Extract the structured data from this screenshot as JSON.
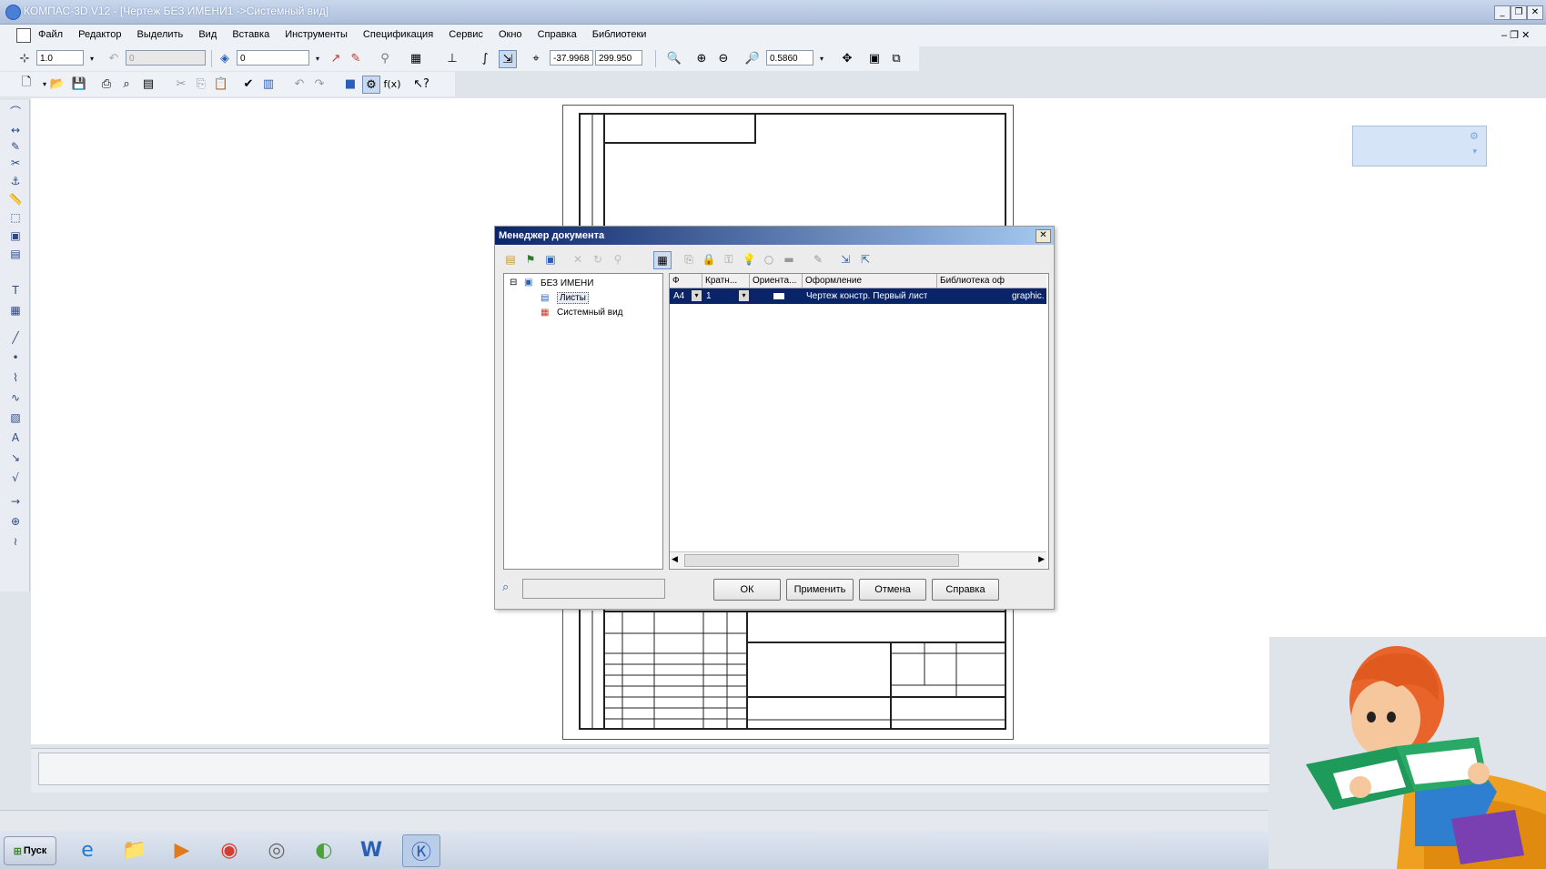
{
  "window": {
    "title": "КОМПАС-3D V12 - [Чертеж БЕЗ ИМЕНИ1 ->Системный вид]",
    "min_label": "_",
    "restore_label": "❐",
    "close_label": "✕"
  },
  "menu": [
    "Файл",
    "Редактор",
    "Выделить",
    "Вид",
    "Вставка",
    "Инструменты",
    "Спецификация",
    "Сервис",
    "Окно",
    "Справка",
    "Библиотеки"
  ],
  "toolbar1": {
    "step_value": "1.0",
    "angle_value": "0",
    "layer_value": "0",
    "coord_x": "-37.9968",
    "coord_y": "299.950",
    "zoom_value": "0.5860"
  },
  "dialog": {
    "title": "Менеджер документа",
    "close_label": "✕",
    "tree": {
      "root": "БЕЗ ИМЕНИ",
      "child1": "Листы",
      "child2": "Системный вид",
      "expander": "⊟"
    },
    "columns": [
      "Ф",
      "Кратн...",
      "Ориента...",
      "Оформление",
      "Библиотека оф"
    ],
    "row": {
      "format": "А4",
      "multiplicity": "1",
      "design": "Чертеж констр. Первый лист",
      "library": "graphic."
    },
    "buttons": {
      "ok": "ОК",
      "apply": "Применить",
      "cancel": "Отмена",
      "help": "Справка"
    }
  },
  "taskbar": {
    "start_label": "Пуск"
  },
  "colors": {
    "dialog_title_start": "#0a246a",
    "selection": "#0a246a",
    "title_bar": "#aebfdc"
  }
}
